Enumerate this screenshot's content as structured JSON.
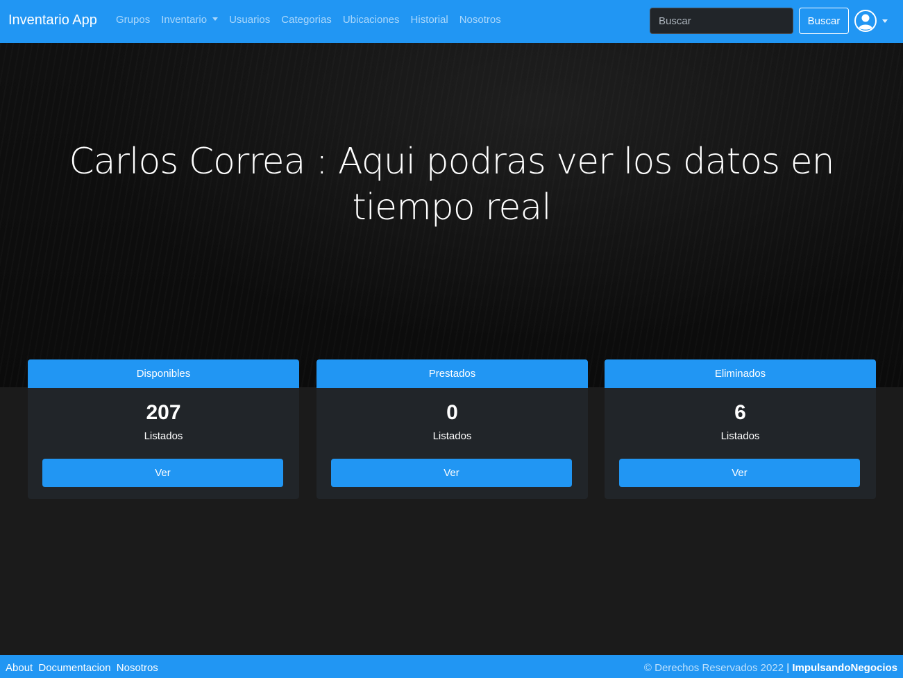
{
  "navbar": {
    "brand": "Inventario App",
    "links": [
      {
        "label": "Grupos"
      },
      {
        "label": "Inventario"
      },
      {
        "label": "Usuarios"
      },
      {
        "label": "Categorias"
      },
      {
        "label": "Ubicaciones"
      },
      {
        "label": "Historial"
      },
      {
        "label": "Nosotros"
      }
    ],
    "search_placeholder": "Buscar",
    "search_value": "",
    "search_button": "Buscar",
    "user_icon": "user-circle-icon"
  },
  "hero": {
    "title": "Carlos Correa : Aqui podras ver los datos en tiempo real"
  },
  "cards": [
    {
      "header": "Disponibles",
      "count": "207",
      "sub": "Listados",
      "button": "Ver"
    },
    {
      "header": "Prestados",
      "count": "0",
      "sub": "Listados",
      "button": "Ver"
    },
    {
      "header": "Eliminados",
      "count": "6",
      "sub": "Listados",
      "button": "Ver"
    }
  ],
  "footer": {
    "links": [
      "About",
      "Documentacion",
      "Nosotros"
    ],
    "copyright": "© Derechos Reservados 2022",
    "separator": "|",
    "company": "ImpulsandoNegocios"
  },
  "colors": {
    "primary": "#2196f3",
    "card_body": "#212529",
    "page_background": "#1b1b1b",
    "hero_background": "#0d0d0d"
  }
}
